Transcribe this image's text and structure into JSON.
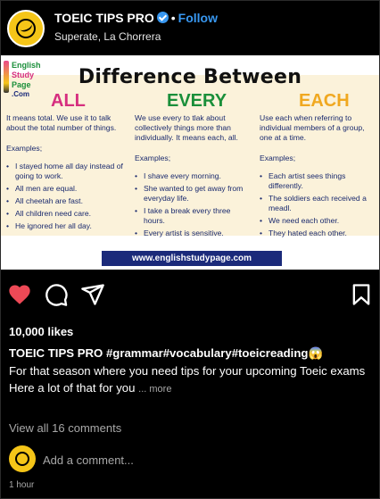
{
  "header": {
    "account_name": "TOEIC TIPS PRO",
    "separator": "•",
    "follow_label": "Follow",
    "location": "Superate, La Chorrera"
  },
  "post_image": {
    "logo": {
      "line1": "English",
      "line2": "Study",
      "line3": "Page",
      "line4": ".Com"
    },
    "title": "Difference Between",
    "columns": [
      {
        "heading": "ALL",
        "description": "It means total. We use it to talk about the total number of things.",
        "examples_label": "Examples;",
        "examples": [
          "I stayed home all day instead of going to work.",
          "All men are equal.",
          "All cheetah are fast.",
          "All children need care.",
          "He ignored her all day."
        ]
      },
      {
        "heading": "EVERY",
        "description": "We use every to tlak about collectively things more than individually. It means each, all.",
        "examples_label": "Examples;",
        "examples": [
          "I shave every morning.",
          "She wanted to get away from everyday life.",
          "I take a break every three hours.",
          "Every artist is sensitive."
        ]
      },
      {
        "heading": "EACH",
        "description": "Use each when referring to individual members of a group, one at a time.",
        "examples_label": "Examples;",
        "examples": [
          "Each artist sees things differently.",
          "The soldiers each received a meadl.",
          "We need each other.",
          "They hated each other."
        ]
      }
    ],
    "website": "www.englishstudypage.com"
  },
  "actions": {
    "like_icon": "heart-filled-icon",
    "comment_icon": "comment-icon",
    "share_icon": "paper-plane-icon",
    "save_icon": "bookmark-icon",
    "like_color": "#ed4956"
  },
  "engagement": {
    "likes": "10,000 likes"
  },
  "caption": {
    "username": "TOEIC TIPS PRO",
    "hashtags": "#grammar#vocabulary#toeicreading",
    "emoji": "😱",
    "line1": "For that season where you need tips for your upcoming Toeic exams",
    "line2": "Here a lot of that for you",
    "more_label": "... more"
  },
  "comments": {
    "view_all": "View all 16 comments",
    "add_placeholder": "Add a comment..."
  },
  "timestamp": "1 hour",
  "colors": {
    "accent": "#3897f0",
    "brand_yellow": "#f5c518",
    "all_pink": "#d62e7f",
    "every_green": "#1a8f3a",
    "each_orange": "#f0a820",
    "navy": "#1b2a7a"
  }
}
